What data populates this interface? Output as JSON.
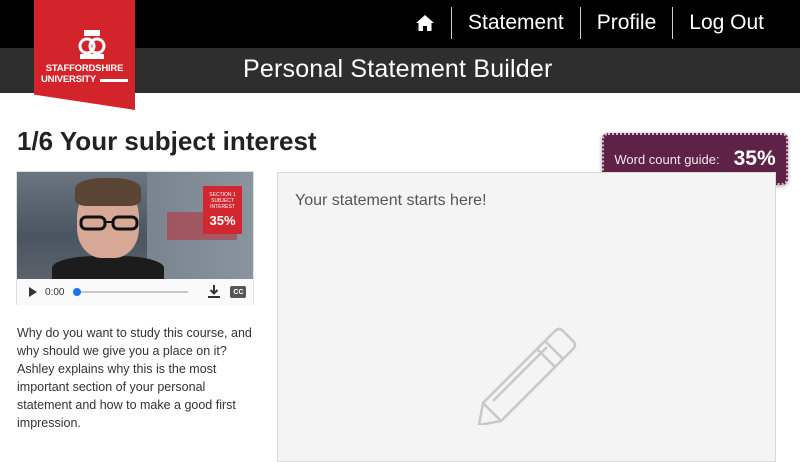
{
  "header": {
    "brand_line1": "STAFFORDSHIRE",
    "brand_line2": "UNIVERSITY",
    "app_title": "Personal Statement Builder",
    "nav": {
      "home_icon": "home-icon",
      "items": [
        "Statement",
        "Profile",
        "Log Out"
      ]
    }
  },
  "section": {
    "title": "1/6 Your subject interest"
  },
  "word_count": {
    "label": "Word count guide:",
    "value": "35%"
  },
  "video": {
    "badge": {
      "line1": "SECTION 1",
      "line2": "SUBJECT",
      "line3": "INTEREST",
      "percent": "35%"
    },
    "time": "0:00",
    "cc_label": "CC",
    "progress": 0
  },
  "description": "Why do you want to study this course, and why should we give you a place on it? Ashley explains why this is the most important section of your personal statement and how to make a good first impression.",
  "editor": {
    "placeholder": "Your statement starts here!"
  },
  "colors": {
    "brand_red": "#d3232b",
    "word_count_bg": "#5e2247",
    "topbar": "#000000",
    "subbar": "#2e2e2e"
  }
}
